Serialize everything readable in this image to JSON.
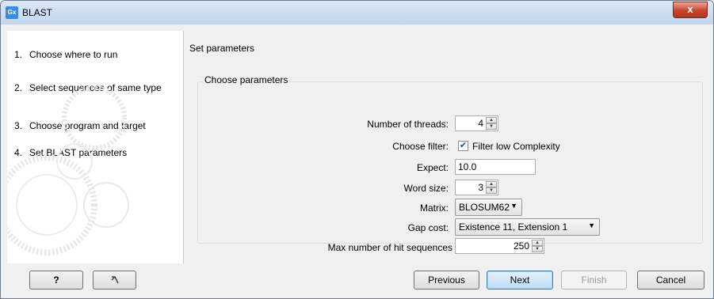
{
  "window": {
    "app_icon": "Gx",
    "title": "BLAST",
    "close_glyph": "x"
  },
  "steps": [
    {
      "num": "1.",
      "label": "Choose where to run"
    },
    {
      "num": "2.",
      "label": "Select sequences of same type"
    },
    {
      "num": "3.",
      "label": "Choose program and target"
    },
    {
      "num": "4.",
      "label": "Set BLAST parameters"
    }
  ],
  "main": {
    "heading": "Set parameters",
    "group_title": "Choose parameters",
    "params": {
      "threads": {
        "label": "Number of threads:",
        "value": "4"
      },
      "filter": {
        "label": "Choose filter:",
        "checkbox_label": "Filter low Complexity",
        "checked": true
      },
      "expect": {
        "label": "Expect:",
        "value": "10.0"
      },
      "word_size": {
        "label": "Word size:",
        "value": "3"
      },
      "matrix": {
        "label": "Matrix:",
        "value": "BLOSUM62"
      },
      "gap_cost": {
        "label": "Gap cost:",
        "value": "Existence 11, Extension 1"
      },
      "max_hits": {
        "label": "Max number of hit sequences",
        "value": "250"
      }
    }
  },
  "buttons": {
    "help": "?",
    "previous": "Previous",
    "next": "Next",
    "finish": "Finish",
    "cancel": "Cancel"
  },
  "icons": {
    "help": "help-icon",
    "reset": "reset-arrow-icon",
    "close": "close-icon",
    "spin_up": "spin-up-icon",
    "spin_down": "spin-down-icon",
    "dropdown": "chevron-down-icon"
  },
  "colors": {
    "titlebar": "#c3d6ee",
    "close_button": "#c7452d",
    "default_button": "#bfdcf3",
    "window_bg": "#f0f0f0"
  }
}
